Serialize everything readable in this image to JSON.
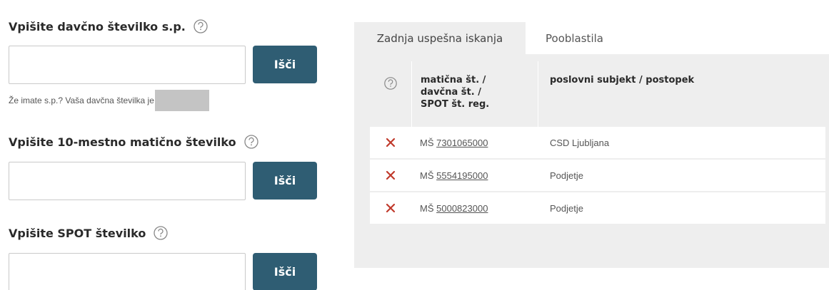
{
  "tax_search": {
    "label": "Vpišite davčno številko s.p.",
    "input_value": "",
    "button_label": "Išči",
    "hint_text": "Že imate s.p.? Vaša davčna številka je"
  },
  "reg_search": {
    "label": "Vpišite 10-mestno matično številko",
    "input_value": "",
    "button_label": "Išči"
  },
  "spot_search": {
    "label": "Vpišite SPOT številko",
    "input_value": "",
    "button_label": "Išči"
  },
  "tabs": [
    {
      "label": "Zadnja uspešna iskanja",
      "active": true
    },
    {
      "label": "Pooblastila",
      "active": false
    }
  ],
  "results_table": {
    "header_id_lines": [
      "matična št. /",
      "davčna št. /",
      "SPOT št. reg."
    ],
    "header_subject": "poslovni subjekt / postopek",
    "rows": [
      {
        "prefix": "MŠ",
        "number": "7301065000",
        "subject": "CSD Ljubljana"
      },
      {
        "prefix": "MŠ",
        "number": "5554195000",
        "subject": "Podjetje"
      },
      {
        "prefix": "MŠ",
        "number": "5000823000",
        "subject": "Podjetje"
      }
    ]
  },
  "icons": {
    "help": "help-question-icon",
    "remove": "remove-x-icon"
  },
  "colors": {
    "button": "#2f5d73",
    "remove_x": "#c0392b",
    "panel_bg": "#eeeeee"
  }
}
